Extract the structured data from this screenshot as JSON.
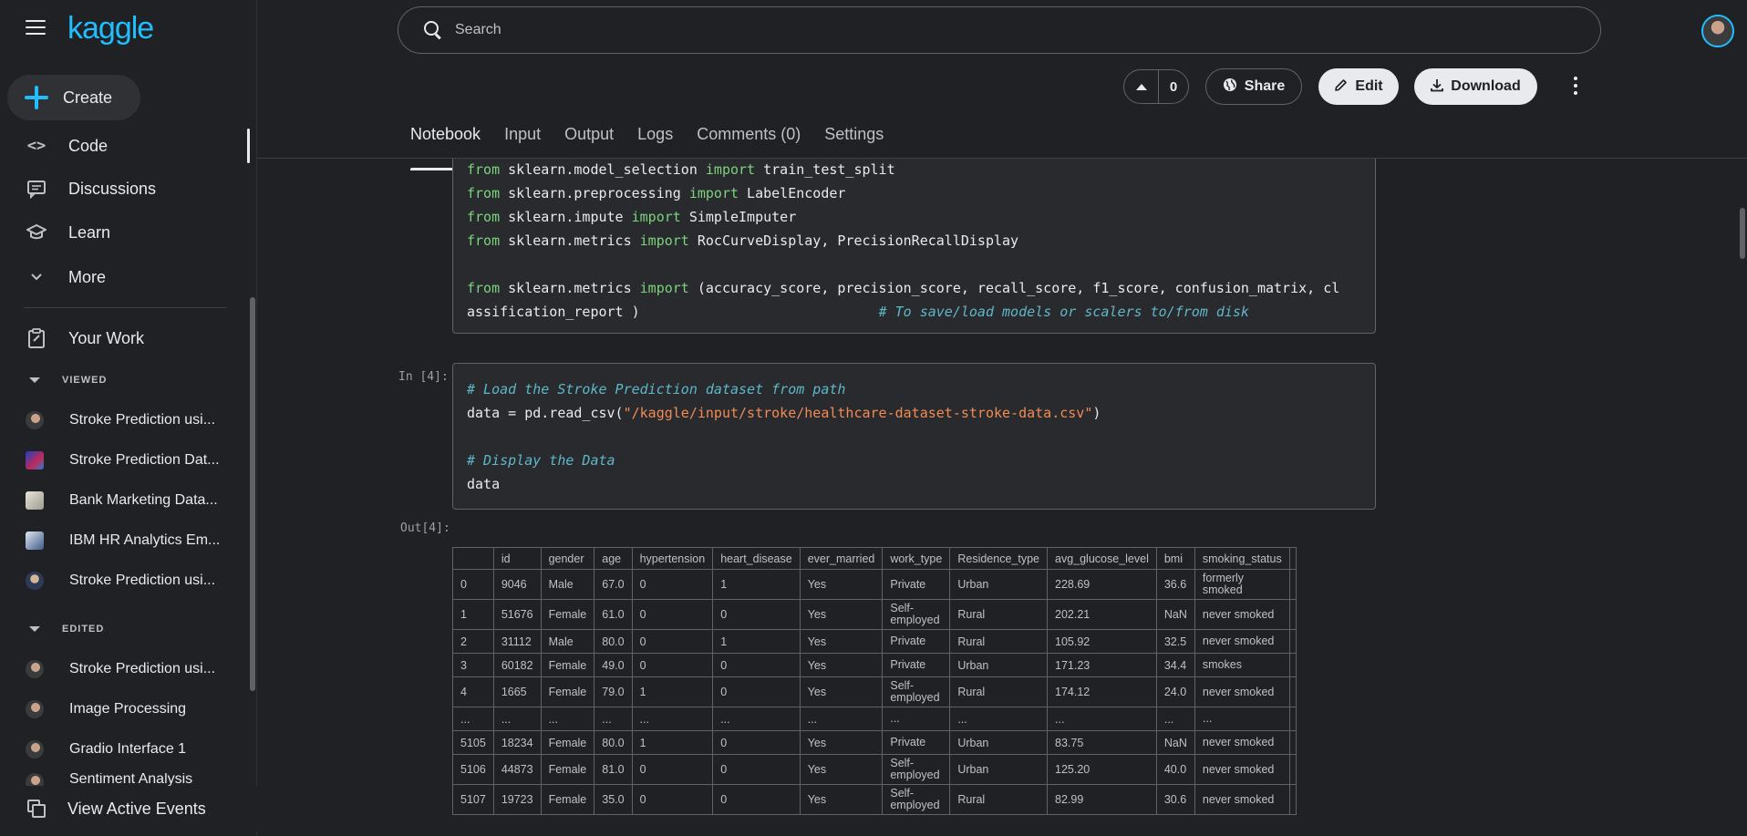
{
  "app": {
    "logo": "kaggle",
    "create_label": "Create"
  },
  "sidebar": {
    "nav": [
      {
        "label": "Code",
        "icon": "code-icon",
        "glyph": "<>"
      },
      {
        "label": "Discussions",
        "icon": "discussions-icon",
        "glyph": "▤"
      },
      {
        "label": "Learn",
        "icon": "learn-icon",
        "glyph": "🎓"
      },
      {
        "label": "More",
        "icon": "chevron-down-icon",
        "glyph": "⌄"
      }
    ],
    "your_work": "Your Work",
    "viewed_header": "VIEWED",
    "viewed": [
      "Stroke Prediction usi...",
      "Stroke Prediction Dat...",
      "Bank Marketing Data...",
      "IBM HR Analytics Em...",
      "Stroke Prediction usi..."
    ],
    "edited_header": "EDITED",
    "edited": [
      "Stroke Prediction usi...",
      "Image Processing",
      "Gradio Interface 1",
      "Sentiment Analysis"
    ],
    "view_active_events": "View Active Events"
  },
  "search": {
    "placeholder": "Search"
  },
  "toolbar": {
    "vote_count": "0",
    "share": "Share",
    "edit": "Edit",
    "download": "Download"
  },
  "tabs": [
    "Notebook",
    "Input",
    "Output",
    "Logs",
    "Comments (0)",
    "Settings"
  ],
  "cell3": {
    "lines": [
      {
        "kw1": "from",
        "mod": " sklearn.model_selection ",
        "kw2": "import",
        "rest": " train_test_split"
      },
      {
        "kw1": "from",
        "mod": " sklearn.preprocessing ",
        "kw2": "import",
        "rest": " LabelEncoder"
      },
      {
        "kw1": "from",
        "mod": " sklearn.impute ",
        "kw2": "import",
        "rest": " SimpleImputer"
      },
      {
        "kw1": "from",
        "mod": " sklearn.metrics ",
        "kw2": "import",
        "rest": " RocCurveDisplay, PrecisionRecallDisplay"
      },
      {
        "kw1": "",
        "mod": "",
        "kw2": "",
        "rest": ""
      },
      {
        "kw1": "from",
        "mod": " sklearn.metrics ",
        "kw2": "import",
        "rest": " (accuracy_score, precision_score, recall_score, f1_score, confusion_matrix, cl"
      }
    ],
    "last_line": "assification_report )",
    "last_comment": "# To save/load models or scalers to/from disk"
  },
  "cell4": {
    "prompt": "In [4]:",
    "comment1": "# Load the Stroke Prediction dataset from path",
    "read_prefix": "data = pd.read_csv(",
    "read_path": "\"/kaggle/input/stroke/healthcare-dataset-stroke-data.csv\"",
    "read_suffix": ")",
    "comment2": "# Display the Data",
    "last": "data"
  },
  "output": {
    "prompt": "Out[4]:",
    "columns": [
      "",
      "id",
      "gender",
      "age",
      "hypertension",
      "heart_disease",
      "ever_married",
      "work_type",
      "Residence_type",
      "avg_glucose_level",
      "bmi",
      "smoking_status"
    ],
    "rows": [
      [
        "0",
        "9046",
        "Male",
        "67.0",
        "0",
        "1",
        "Yes",
        "Private",
        "Urban",
        "228.69",
        "36.6",
        "formerly smoked"
      ],
      [
        "1",
        "51676",
        "Female",
        "61.0",
        "0",
        "0",
        "Yes",
        "Self-employed",
        "Rural",
        "202.21",
        "NaN",
        "never smoked"
      ],
      [
        "2",
        "31112",
        "Male",
        "80.0",
        "0",
        "1",
        "Yes",
        "Private",
        "Rural",
        "105.92",
        "32.5",
        "never smoked"
      ],
      [
        "3",
        "60182",
        "Female",
        "49.0",
        "0",
        "0",
        "Yes",
        "Private",
        "Urban",
        "171.23",
        "34.4",
        "smokes"
      ],
      [
        "4",
        "1665",
        "Female",
        "79.0",
        "1",
        "0",
        "Yes",
        "Self-employed",
        "Rural",
        "174.12",
        "24.0",
        "never smoked"
      ],
      [
        "...",
        "...",
        "...",
        "...",
        "...",
        "...",
        "...",
        "...",
        "...",
        "...",
        "...",
        "..."
      ],
      [
        "5105",
        "18234",
        "Female",
        "80.0",
        "1",
        "0",
        "Yes",
        "Private",
        "Urban",
        "83.75",
        "NaN",
        "never smoked"
      ],
      [
        "5106",
        "44873",
        "Female",
        "81.0",
        "0",
        "0",
        "Yes",
        "Self-employed",
        "Urban",
        "125.20",
        "40.0",
        "never smoked"
      ],
      [
        "5107",
        "19723",
        "Female",
        "35.0",
        "0",
        "0",
        "Yes",
        "Self-employed",
        "Rural",
        "82.99",
        "30.6",
        "never smoked"
      ]
    ]
  }
}
